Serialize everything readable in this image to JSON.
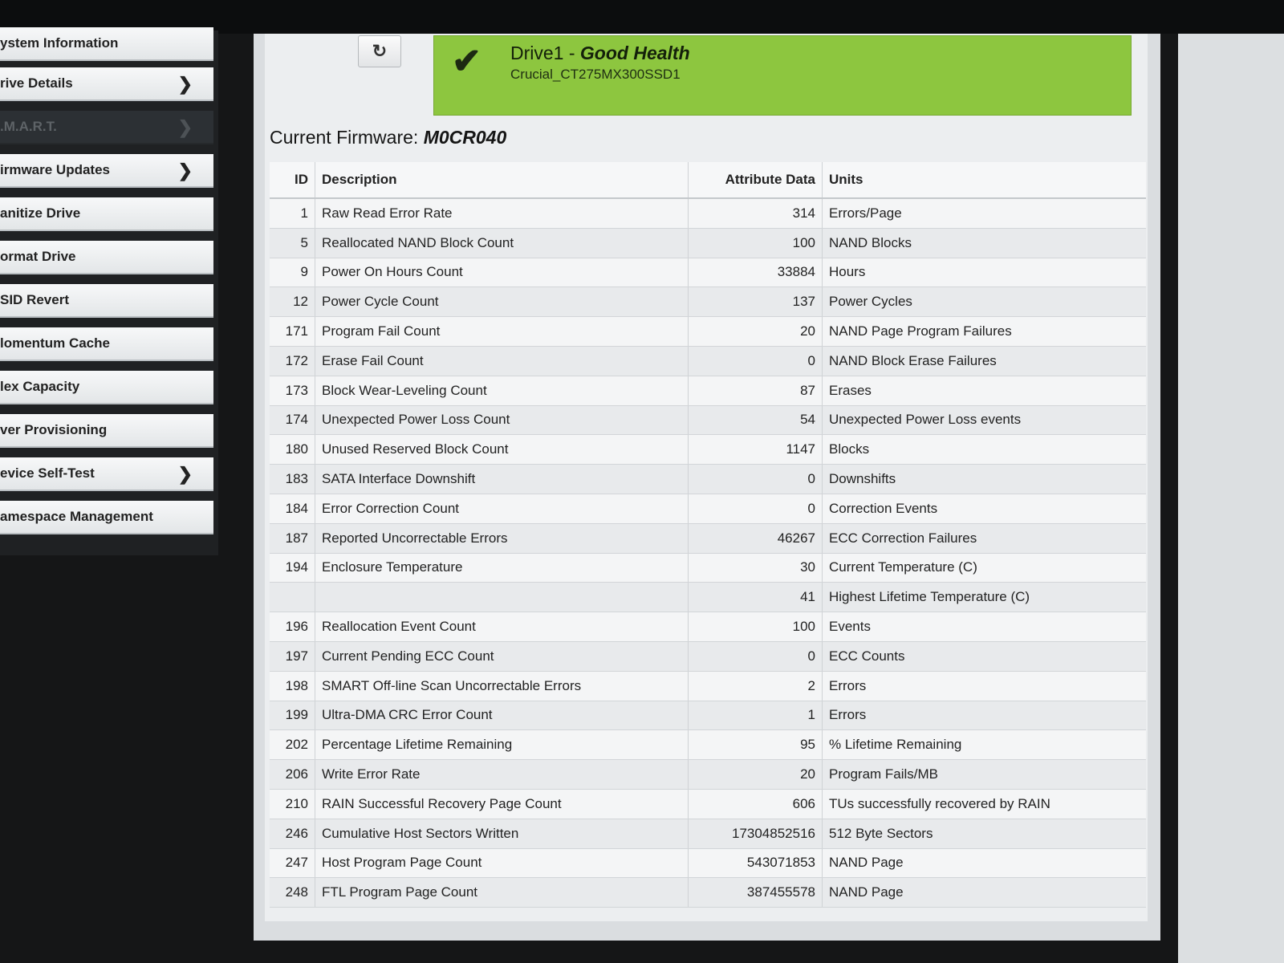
{
  "sidebar": {
    "items": [
      {
        "label": "ystem Information",
        "chevron": false
      },
      {
        "label": "rive Details",
        "chevron": true
      },
      {
        "label": ".M.A.R.T.",
        "chevron": true,
        "selected": true
      },
      {
        "label": "irmware Updates",
        "chevron": true
      },
      {
        "label": "anitize Drive",
        "chevron": false
      },
      {
        "label": "ormat Drive",
        "chevron": false
      },
      {
        "label": "SID Revert",
        "chevron": false
      },
      {
        "label": "lomentum Cache",
        "chevron": false
      },
      {
        "label": "lex Capacity",
        "chevron": false
      },
      {
        "label": "ver Provisioning",
        "chevron": false
      },
      {
        "label": "evice Self-Test",
        "chevron": true
      },
      {
        "label": "amespace Management",
        "chevron": false
      }
    ]
  },
  "icons": {
    "refresh": "refresh-icon",
    "check": "checkmark-icon",
    "chevron": "chevron-right-icon"
  },
  "colors": {
    "health_green": "#8dc63f",
    "sidebar_dark": "#1f2123"
  },
  "health": {
    "drive": "Drive1 - ",
    "status": "Good Health",
    "model": "Crucial_CT275MX300SSD1"
  },
  "firmware": {
    "label": "Current Firmware: ",
    "value": "M0CR040"
  },
  "table": {
    "headers": {
      "id": "ID",
      "description": "Description",
      "data": "Attribute Data",
      "units": "Units"
    },
    "rows": [
      {
        "id": "1",
        "desc": "Raw Read Error Rate",
        "value": "314",
        "units": "Errors/Page"
      },
      {
        "id": "5",
        "desc": "Reallocated NAND Block Count",
        "value": "100",
        "units": "NAND Blocks"
      },
      {
        "id": "9",
        "desc": "Power On Hours Count",
        "value": "33884",
        "units": "Hours"
      },
      {
        "id": "12",
        "desc": "Power Cycle Count",
        "value": "137",
        "units": "Power Cycles"
      },
      {
        "id": "171",
        "desc": "Program Fail Count",
        "value": "20",
        "units": "NAND Page Program Failures"
      },
      {
        "id": "172",
        "desc": "Erase Fail Count",
        "value": "0",
        "units": "NAND Block Erase Failures"
      },
      {
        "id": "173",
        "desc": "Block Wear-Leveling Count",
        "value": "87",
        "units": "Erases"
      },
      {
        "id": "174",
        "desc": "Unexpected Power Loss Count",
        "value": "54",
        "units": "Unexpected Power Loss events"
      },
      {
        "id": "180",
        "desc": "Unused Reserved Block Count",
        "value": "1147",
        "units": "Blocks"
      },
      {
        "id": "183",
        "desc": "SATA Interface Downshift",
        "value": "0",
        "units": "Downshifts"
      },
      {
        "id": "184",
        "desc": "Error Correction Count",
        "value": "0",
        "units": "Correction Events"
      },
      {
        "id": "187",
        "desc": "Reported Uncorrectable Errors",
        "value": "46267",
        "units": "ECC Correction Failures"
      },
      {
        "id": "194",
        "desc": "Enclosure Temperature",
        "value": "30",
        "units": "Current Temperature (C)"
      },
      {
        "id": "",
        "desc": "",
        "value": "41",
        "units": "Highest Lifetime Temperature (C)"
      },
      {
        "id": "196",
        "desc": "Reallocation Event Count",
        "value": "100",
        "units": "Events"
      },
      {
        "id": "197",
        "desc": "Current Pending ECC Count",
        "value": "0",
        "units": "ECC Counts"
      },
      {
        "id": "198",
        "desc": "SMART Off-line Scan Uncorrectable Errors",
        "value": "2",
        "units": "Errors"
      },
      {
        "id": "199",
        "desc": "Ultra-DMA CRC Error Count",
        "value": "1",
        "units": "Errors"
      },
      {
        "id": "202",
        "desc": "Percentage Lifetime Remaining",
        "value": "95",
        "units": "% Lifetime Remaining"
      },
      {
        "id": "206",
        "desc": "Write Error Rate",
        "value": "20",
        "units": "Program Fails/MB"
      },
      {
        "id": "210",
        "desc": "RAIN Successful Recovery Page Count",
        "value": "606",
        "units": "TUs successfully recovered by RAIN"
      },
      {
        "id": "246",
        "desc": "Cumulative Host Sectors Written",
        "value": "17304852516",
        "units": "512 Byte Sectors"
      },
      {
        "id": "247",
        "desc": "Host Program Page Count",
        "value": "543071853",
        "units": "NAND Page"
      },
      {
        "id": "248",
        "desc": "FTL Program Page Count",
        "value": "387455578",
        "units": "NAND Page"
      }
    ]
  }
}
